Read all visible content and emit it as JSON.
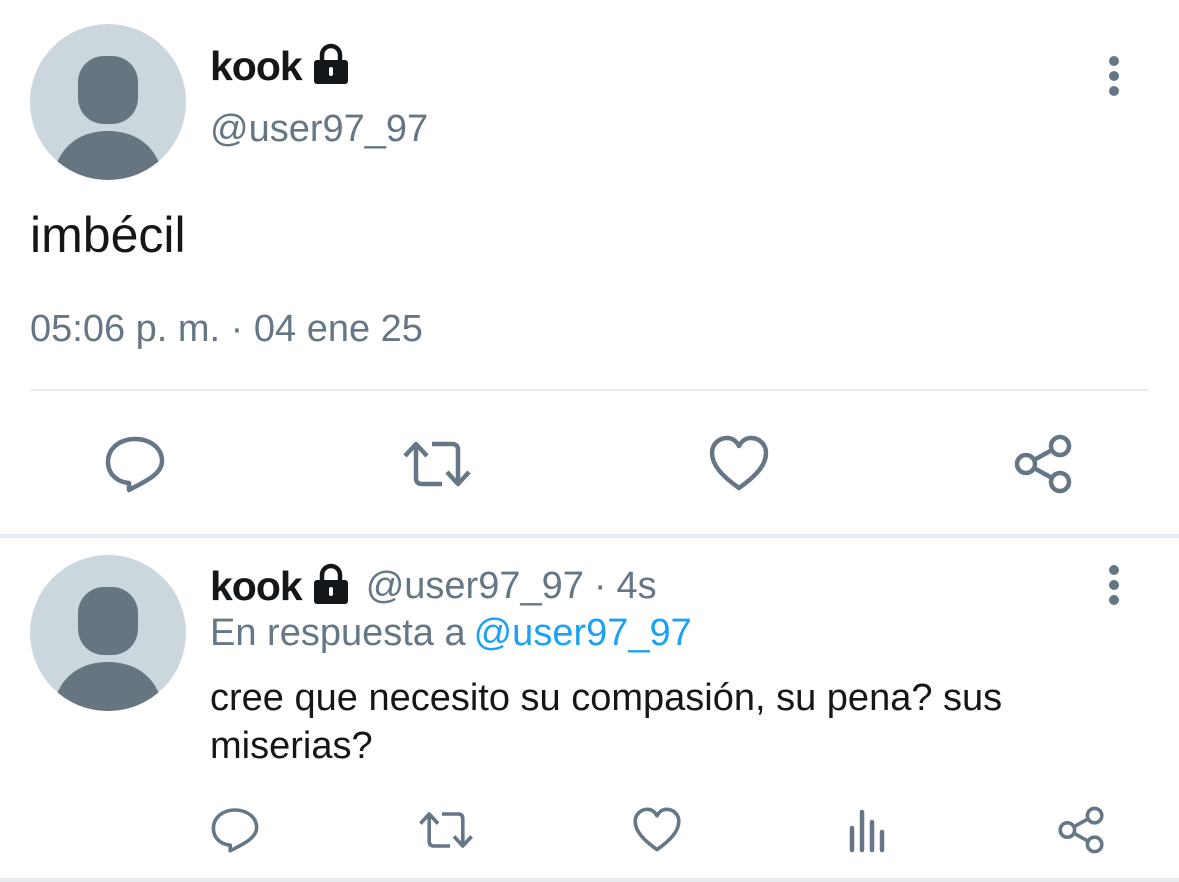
{
  "main_tweet": {
    "display_name": "kook",
    "handle": "@user97_97",
    "text": "imbécil",
    "timestamp": "05:06 p. m. · 04 ene 25",
    "icons": {
      "protected": "lock-icon",
      "more": "more-vertical-icon",
      "reply": "reply-icon",
      "retweet": "retweet-icon",
      "like": "heart-icon",
      "share": "share-icon"
    }
  },
  "reply_tweet": {
    "display_name": "kook",
    "handle": "@user97_97",
    "separator": "·",
    "age": "4s",
    "replying_to_label": "En respuesta a",
    "replying_to_handle": "@user97_97",
    "text": "cree que necesito su compasión, su pena? sus miserias?",
    "icons": {
      "protected": "lock-icon",
      "more": "more-vertical-icon",
      "reply": "reply-icon",
      "retweet": "retweet-icon",
      "like": "heart-icon",
      "stats": "analytics-icon",
      "share": "share-icon"
    }
  },
  "colors": {
    "text_primary": "#14171a",
    "text_secondary": "#657786",
    "link": "#1da1f2",
    "icon": "#657786",
    "divider": "#e6ecf0",
    "avatar_bg": "#ccd6dd",
    "avatar_fg": "#66757f"
  }
}
